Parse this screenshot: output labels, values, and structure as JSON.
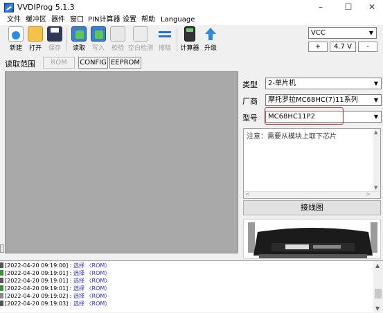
{
  "window": {
    "title": "VVDIProg 5.1.3",
    "minimize": "–",
    "maximize": "☐",
    "close": "✕"
  },
  "menu": [
    "文件",
    "缓冲区",
    "器件",
    "窗口",
    "PIN计算器",
    "设置",
    "帮助",
    "Language"
  ],
  "toolbar": {
    "buttons": [
      {
        "label": "新建",
        "icon": "new-file-icon",
        "enabled": true
      },
      {
        "label": "打开",
        "icon": "open-folder-icon",
        "enabled": true
      },
      {
        "label": "保存",
        "icon": "save-disk-icon",
        "enabled": false
      },
      {
        "label": "读取",
        "icon": "read-chip-icon",
        "enabled": true
      },
      {
        "label": "写入",
        "icon": "write-chip-icon",
        "enabled": false
      },
      {
        "label": "校验",
        "icon": "verify-icon",
        "enabled": false
      },
      {
        "label": "空白检测",
        "icon": "blank-check-icon",
        "enabled": false
      },
      {
        "label": "擦除",
        "icon": "erase-icon",
        "enabled": false
      },
      {
        "label": "计算器",
        "icon": "calculator-icon",
        "enabled": true
      },
      {
        "label": "升级",
        "icon": "upgrade-arrow-icon",
        "enabled": true
      }
    ],
    "power_select": "VCC",
    "voltage_plus": "+",
    "voltage_value": "4.7 V",
    "voltage_minus": "-"
  },
  "range": {
    "label": "读取范围",
    "tabs": [
      {
        "label": "ROM",
        "active": false
      },
      {
        "label": "CONFIG",
        "active": true
      },
      {
        "label": "EEPROM",
        "active": true
      }
    ]
  },
  "device": {
    "type_label": "类型",
    "type_value": "2-单片机",
    "vendor_label": "厂商",
    "vendor_value": "摩托罗拉MC68HC(7)11系列",
    "model_label": "型号",
    "model_value": "MC68HC11P2",
    "note": "注意：需要从模块上取下芯片",
    "wiring_button": "接线图",
    "highlight_color": "#e02020"
  },
  "log": {
    "entries": [
      {
        "time": "[2022-04-20 09:19:00] : ",
        "action": "选择 〈ROM〉"
      },
      {
        "time": "[2022-04-20 09:19:01] : ",
        "action": "选择 〈ROM〉"
      },
      {
        "time": "[2022-04-20 09:19:01] : ",
        "action": "选择 〈ROM〉"
      },
      {
        "time": "[2022-04-20 09:19:01] : ",
        "action": "选择 〈ROM〉"
      },
      {
        "time": "[2022-04-20 09:19:02] : ",
        "action": "选择 〈ROM〉"
      },
      {
        "time": "[2022-04-20 09:19:03] : ",
        "action": "选择 〈ROM〉"
      }
    ]
  }
}
